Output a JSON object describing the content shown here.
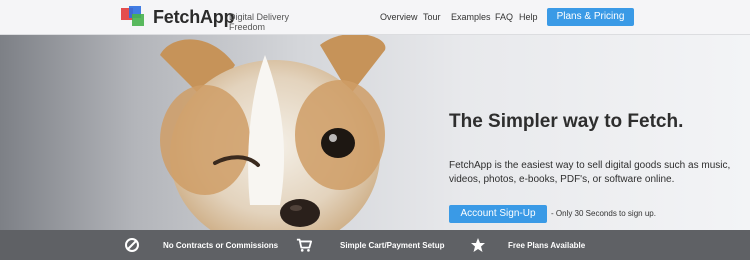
{
  "header": {
    "brand": "FetchApp",
    "tagline": "Digital Delivery Freedom",
    "nav": [
      "Overview",
      "Tour",
      "Examples",
      "FAQ",
      "Help"
    ],
    "plans_button": "Plans & Pricing"
  },
  "hero": {
    "headline": "The Simpler way to Fetch.",
    "description": "FetchApp is the easiest way to sell digital goods such as music, videos, photos, e-books, PDF's, or software online.",
    "signup_button": "Account Sign-Up",
    "signup_note": "- Only 30 Seconds to sign up."
  },
  "features": [
    {
      "icon": "no-sign-icon",
      "label": "No Contracts or Commissions"
    },
    {
      "icon": "cart-icon",
      "label": "Simple Cart/Payment Setup"
    },
    {
      "icon": "star-icon",
      "label": "Free Plans Available"
    }
  ]
}
